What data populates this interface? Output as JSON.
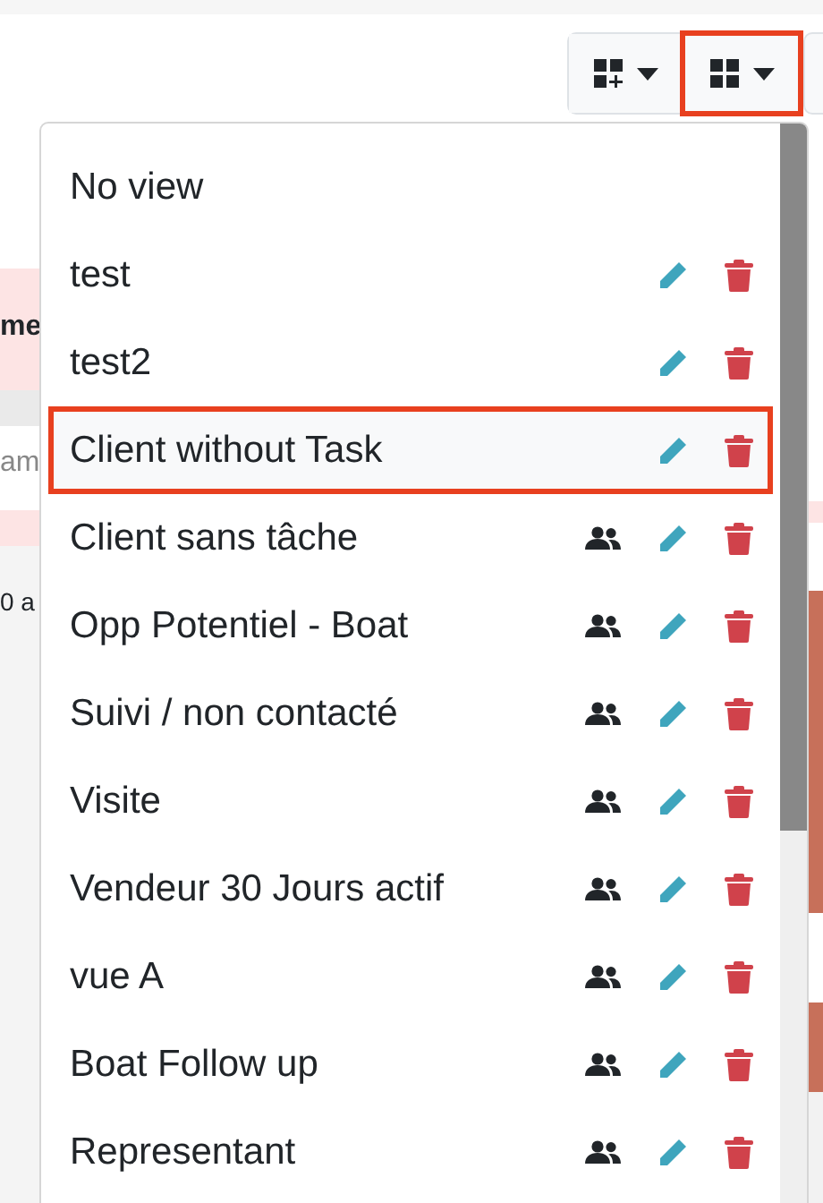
{
  "toolbar": {
    "buttons": [
      {
        "kind": "add-view",
        "selected": false
      },
      {
        "kind": "views",
        "selected": true
      }
    ]
  },
  "background": {
    "left": [
      {
        "text": "me",
        "kind": "header"
      },
      {
        "text": "am",
        "kind": "input"
      },
      {
        "text": "0 a",
        "kind": "plain"
      }
    ]
  },
  "menu": {
    "items": [
      {
        "label": "No view",
        "kind": "none",
        "selected": false,
        "shared": false
      },
      {
        "label": "test",
        "kind": "view",
        "selected": false,
        "shared": false
      },
      {
        "label": "test2",
        "kind": "view",
        "selected": false,
        "shared": false
      },
      {
        "label": "Client without Task",
        "kind": "view",
        "selected": true,
        "shared": false
      },
      {
        "label": "Client sans tâche",
        "kind": "view",
        "selected": false,
        "shared": true
      },
      {
        "label": "Opp Potentiel - Boat",
        "kind": "view",
        "selected": false,
        "shared": true
      },
      {
        "label": "Suivi / non contacté",
        "kind": "view",
        "selected": false,
        "shared": true
      },
      {
        "label": "Visite",
        "kind": "view",
        "selected": false,
        "shared": true
      },
      {
        "label": "Vendeur 30 Jours actif",
        "kind": "view",
        "selected": false,
        "shared": true
      },
      {
        "label": "vue A",
        "kind": "view",
        "selected": false,
        "shared": true
      },
      {
        "label": "Boat Follow up",
        "kind": "view",
        "selected": false,
        "shared": true
      },
      {
        "label": "Representant",
        "kind": "view",
        "selected": false,
        "shared": true
      }
    ]
  }
}
